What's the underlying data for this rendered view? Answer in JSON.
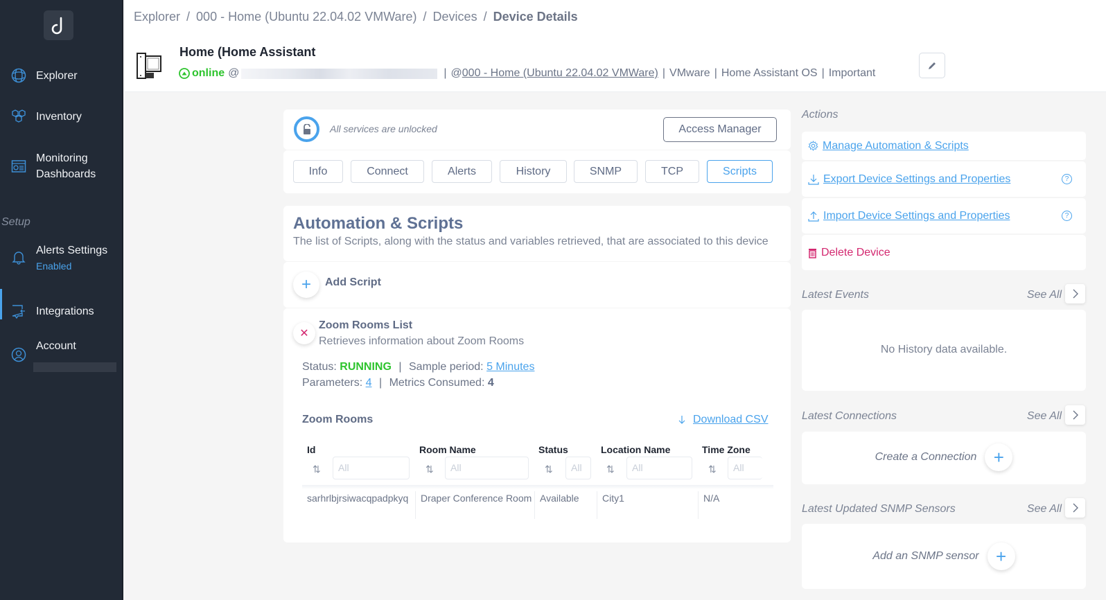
{
  "sidebar": {
    "items": [
      {
        "label": "Explorer",
        "icon": "globe-icon"
      },
      {
        "label": "Inventory",
        "icon": "cubes-icon"
      },
      {
        "label": "Monitoring Dashboards",
        "icon": "dashboard-icon"
      }
    ],
    "setup_label": "Setup",
    "setup_items": [
      {
        "label": "Alerts Settings",
        "sub": "Enabled",
        "icon": "bell-icon"
      },
      {
        "label": "Integrations",
        "icon": "integrations-icon",
        "active": true
      },
      {
        "label": "Account",
        "icon": "user-icon"
      }
    ]
  },
  "breadcrumb": [
    "Explorer",
    "000 - Home (Ubuntu 22.04.02 VMWare)",
    "Devices",
    "Device Details"
  ],
  "device": {
    "title": "Home (Home Assistant",
    "status": "online",
    "at": "@",
    "network_prefix": "@",
    "network": "000 - Home (Ubuntu 22.04.02 VMWare)",
    "vendor": "VMware",
    "os": "Home Assistant OS",
    "importance": "Important",
    "status_color": "#2ec42e"
  },
  "lock": {
    "text": "All services are unlocked",
    "access_button": "Access Manager"
  },
  "tabs": [
    "Info",
    "Connect",
    "Alerts",
    "History",
    "SNMP",
    "TCP",
    "Scripts"
  ],
  "active_tab": "Scripts",
  "automation": {
    "title": "Automation & Scripts",
    "subtitle": "The list of Scripts, along with the status and variables retrieved, that are associated to this device",
    "add_label": "Add Script"
  },
  "script": {
    "name": "Zoom Rooms List",
    "description": "Retrieves information about Zoom Rooms",
    "status_label": "Status:",
    "status": "RUNNING",
    "sample_label": "Sample period:",
    "sample_period": "5 Minutes",
    "params_label": "Parameters:",
    "params": "4",
    "metrics_label": "Metrics Consumed:",
    "metrics": "4",
    "table_title": "Zoom Rooms",
    "download_label": "Download CSV",
    "columns": [
      "Id",
      "Room Name",
      "Status",
      "Location Name",
      "Time Zone"
    ],
    "filter_placeholder": "All",
    "rows": [
      [
        "sarhrlbjrsiwacqpadpkyq",
        "Draper Conference Room",
        "Available",
        "City1",
        "N/A"
      ]
    ]
  },
  "actions": {
    "label": "Actions",
    "items": [
      {
        "label": "Manage Automation & Scripts",
        "icon": "gear-icon"
      },
      {
        "label": "Export Device Settings and Properties",
        "icon": "download-icon",
        "help": "?"
      },
      {
        "label": "Import Device Settings and Properties",
        "icon": "upload-icon",
        "help": "?"
      },
      {
        "label": "Delete Device",
        "icon": "trash-icon"
      }
    ]
  },
  "latest_events": {
    "label": "Latest Events",
    "see_all": "See All",
    "empty": "No History data available."
  },
  "latest_connections": {
    "label": "Latest Connections",
    "see_all": "See All",
    "create": "Create a Connection"
  },
  "latest_snmp": {
    "label": "Latest Updated SNMP Sensors",
    "see_all": "See All",
    "create": "Add an SNMP sensor"
  },
  "colors": {
    "accent": "#4aa3ec",
    "sidebar": "#222a36",
    "danger": "#d3276f",
    "success": "#2ec42e"
  }
}
